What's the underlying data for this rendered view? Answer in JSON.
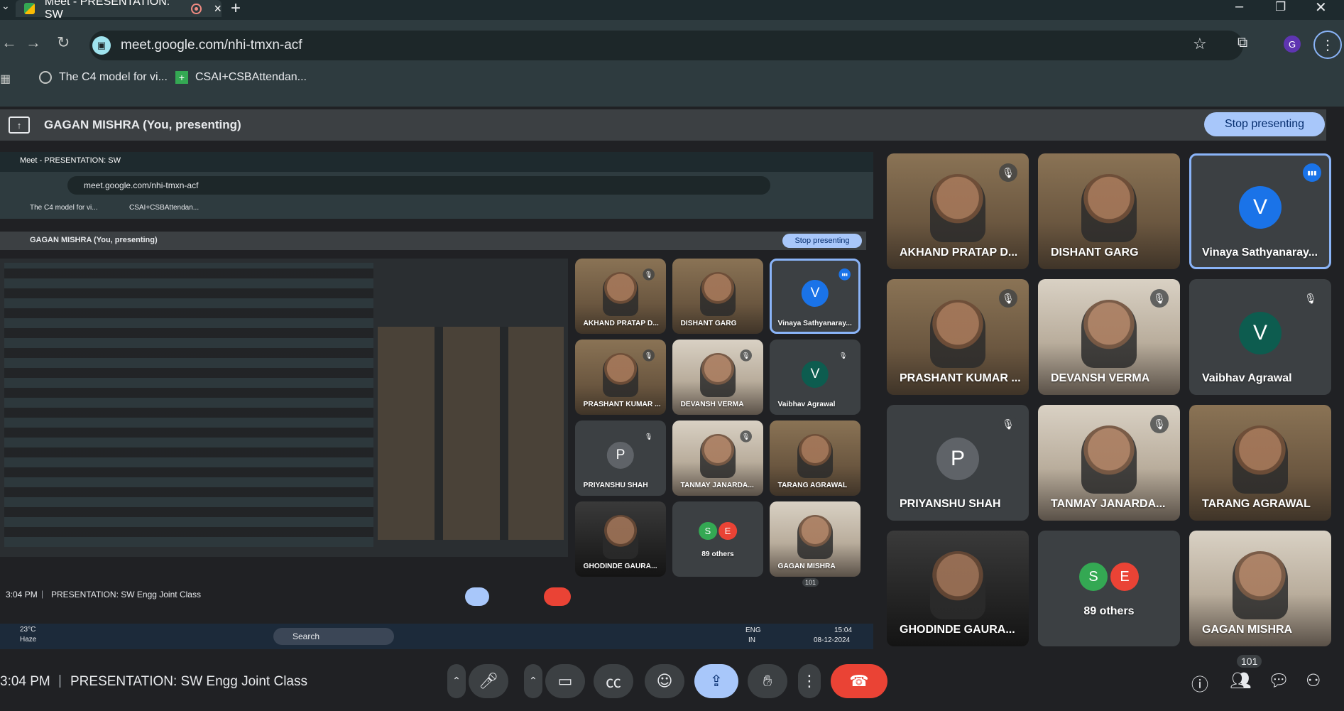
{
  "browser": {
    "tab_title": "Meet - PRESENTATION: SW",
    "new_tab": "+",
    "url": "meet.google.com/nhi-tmxn-acf",
    "profile_initial": "G",
    "bookmarks": [
      {
        "label": "The C4 model for vi..."
      },
      {
        "label": "CSAI+CSBAttendan..."
      }
    ]
  },
  "presenting_bar": {
    "text": "GAGAN MISHRA (You, presenting)",
    "stop_label": "Stop presenting"
  },
  "participants": [
    {
      "name": "AKHAND PRATAP D...",
      "type": "video",
      "muted": true
    },
    {
      "name": "DISHANT GARG",
      "type": "video",
      "muted": false
    },
    {
      "name": "Vinaya Sathyanaray...",
      "type": "avatar",
      "initial": "V",
      "avatar_color": "#1a73e8",
      "speaking": true
    },
    {
      "name": "PRASHANT KUMAR ...",
      "type": "video",
      "muted": true
    },
    {
      "name": "DEVANSH VERMA",
      "type": "video-room",
      "muted": true
    },
    {
      "name": "Vaibhav Agrawal",
      "type": "avatar",
      "initial": "V",
      "avatar_color": "#0d5c4f",
      "muted": true
    },
    {
      "name": "PRIYANSHU SHAH",
      "type": "avatar",
      "initial": "P",
      "avatar_color": "#5f6368",
      "muted": true
    },
    {
      "name": "TANMAY JANARDA...",
      "type": "video-room",
      "muted": true
    },
    {
      "name": "TARANG AGRAWAL",
      "type": "video",
      "muted": false
    },
    {
      "name": "GHODINDE GAURA...",
      "type": "video-dark",
      "muted": false
    },
    {
      "name": "89 others",
      "type": "others",
      "initials": [
        "S",
        "E"
      ]
    },
    {
      "name": "GAGAN MISHRA",
      "type": "video-room",
      "muted": false
    }
  ],
  "bottom": {
    "time": "3:04 PM",
    "separator": "|",
    "meeting_title": "PRESENTATION: SW Engg Joint Class",
    "people_count": "101"
  },
  "nested": {
    "time": "3:04 PM",
    "separator": "|",
    "meeting_title": "PRESENTATION: SW Engg Joint Class",
    "people_count": "101",
    "weather_temp": "23°C",
    "weather_desc": "Haze",
    "search_label": "Search",
    "lang_line1": "ENG",
    "lang_line2": "IN",
    "clock_time": "15:04",
    "clock_date": "08-12-2024"
  },
  "colors": {
    "accent": "#a8c7fa",
    "leave": "#ea4335",
    "background": "#202124"
  }
}
